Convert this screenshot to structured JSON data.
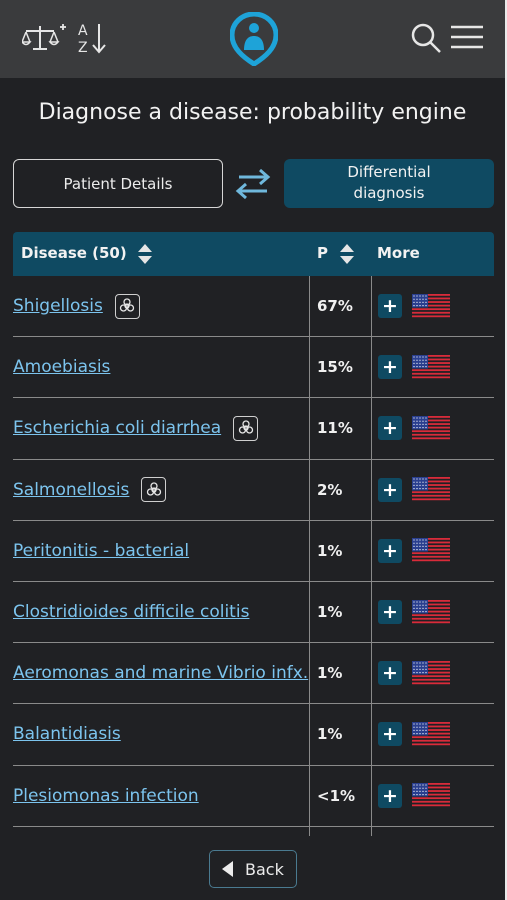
{
  "header": {
    "icons": [
      "scale-icon",
      "sort-az-icon",
      "logo-icon",
      "search-icon",
      "menu-icon"
    ],
    "sort_letters": [
      "A",
      "Z"
    ]
  },
  "title": "Diagnose a disease: probability engine",
  "tabs": {
    "patient_details": "Patient Details",
    "differential_diagnosis": "Differential diagnosis"
  },
  "table": {
    "col_disease": "Disease (50)",
    "col_p": "P",
    "col_more": "More",
    "rows": [
      {
        "name": "Shigellosis",
        "p": "67%",
        "biohazard": true
      },
      {
        "name": "Amoebiasis",
        "p": "15%",
        "biohazard": false
      },
      {
        "name": "Escherichia coli diarrhea",
        "p": "11%",
        "biohazard": true
      },
      {
        "name": "Salmonellosis",
        "p": "2%",
        "biohazard": true
      },
      {
        "name": "Peritonitis - bacterial",
        "p": "1%",
        "biohazard": false
      },
      {
        "name": "Clostridioides difficile colitis",
        "p": "1%",
        "biohazard": false
      },
      {
        "name": "Aeromonas and marine Vibrio infx.",
        "p": "1%",
        "biohazard": false
      },
      {
        "name": "Balantidiasis",
        "p": "1%",
        "biohazard": false
      },
      {
        "name": "Plesiomonas infection",
        "p": "<1%",
        "biohazard": false
      }
    ],
    "plus_label": "+"
  },
  "footer": {
    "back_label": "Back"
  },
  "colors": {
    "background": "#202124",
    "topbar": "#3a3b3d",
    "accent": "#0f4a62",
    "link": "#7cc4ee",
    "logo": "#1ea3d8"
  }
}
